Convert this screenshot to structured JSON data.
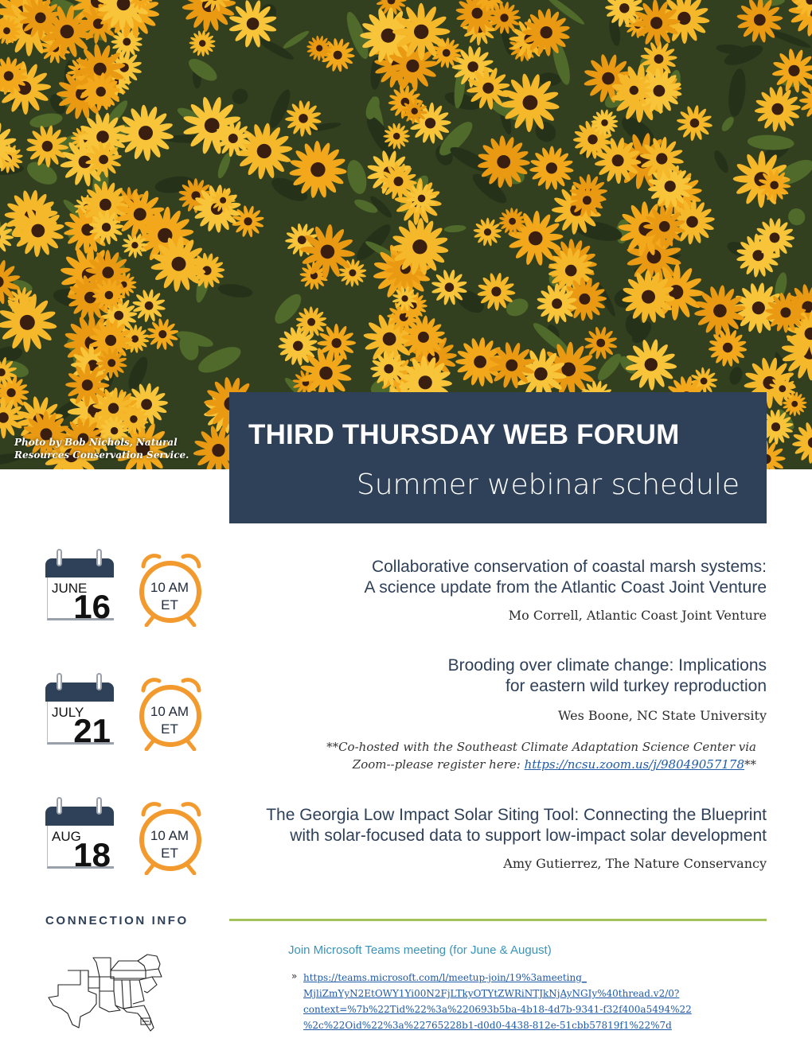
{
  "photo_credit": "Photo by Bob Nichols, Natural Resources Conservation Service.",
  "header": {
    "title": "THIRD THURSDAY WEB FORUM",
    "subtitle": "Summer webinar schedule"
  },
  "events": [
    {
      "month": "JUNE",
      "day": "16",
      "time": "10 AM\nET",
      "title": "Collaborative conservation of coastal marsh systems:\nA science update from the Atlantic Coast Joint Venture",
      "speaker": "Mo Correll, Atlantic Coast Joint Venture"
    },
    {
      "month": "JULY",
      "day": "21",
      "time": "10 AM\nET",
      "title": "Brooding over climate change: Implications\nfor eastern wild turkey reproduction",
      "speaker": "Wes Boone, NC State University",
      "note_prefix": "**Co-hosted with the Southeast Climate Adaptation Science Center via\nZoom--please register here: ",
      "note_link": "https://ncsu.zoom.us/j/98049057178",
      "note_suffix": "**"
    },
    {
      "month": "AUG",
      "day": "18",
      "time": "10 AM\nET",
      "title": "The Georgia Low Impact Solar Siting Tool: Connecting the Blueprint\nwith solar-focused data to support low-impact solar development",
      "speaker": "Amy Gutierrez, The Nature Conservancy"
    }
  ],
  "connection": {
    "heading": "CONNECTION INFO",
    "teams_heading": "Join Microsoft Teams meeting (for June & August)",
    "bullet": "»",
    "teams_link": "https://teams.microsoft.com/l/meetup-join/19%3ameeting_\nMjliZmYyN2EtOWY1Yi00N2FjLTkyOTYtZWRiNTJkNjAyNGIy%40thread.v2/0?\ncontext=%7b%22Tid%22%3a%220693b5ba-4b18-4d7b-9341-f32f400a5494%22\n%2c%22Oid%22%3a%22765228b1-d0d0-4438-812e-51cbb57819f1%22%7d"
  },
  "colors": {
    "navy": "#2f4059",
    "orange": "#f29a2e",
    "green_rule": "#a4c25a",
    "teal_text": "#3a93ba",
    "link": "#1f5aa8"
  }
}
